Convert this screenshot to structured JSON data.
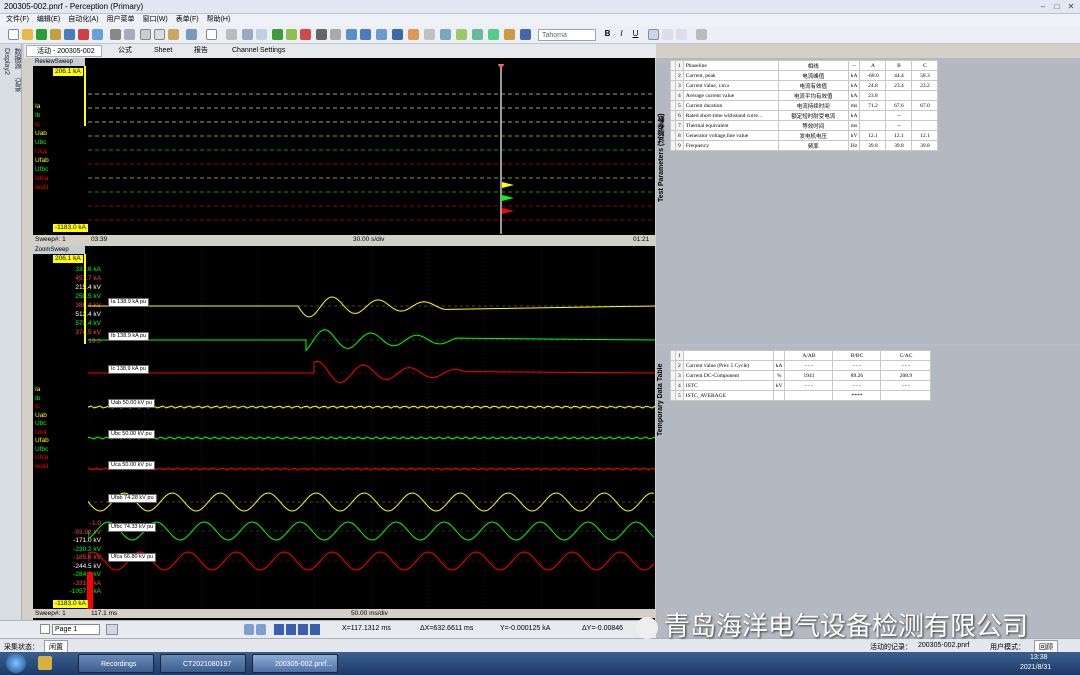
{
  "window": {
    "title": "200305-002.pnrf - Perception (Primary)"
  },
  "menu": [
    "文件(F)",
    "编辑(E)",
    "自动化(A)",
    "用户菜单",
    "窗口(W)",
    "表单(F)",
    "帮助(H)"
  ],
  "toolbar": {
    "font": "Tahoma",
    "bold": "B",
    "italic": "I",
    "underline": "U"
  },
  "tabs": [
    {
      "label": "活动 - 200305-002"
    },
    {
      "label": "公式"
    },
    {
      "label": "Sheet"
    },
    {
      "label": "报告"
    },
    {
      "label": "Channel Settings"
    }
  ],
  "left_strip": {
    "a": "Display2",
    "b": "数据源",
    "c": "记录"
  },
  "review": {
    "header": "ReviewSweep",
    "top_value": "206.1 kA",
    "bottom_value": "-1183.0 kA",
    "sweep": "Sweep#: 1",
    "time_start": "03:39",
    "time_div": "30.00 s/div",
    "time_end": "01:21",
    "channels": [
      {
        "name": "Ia",
        "color": "#ffff00"
      },
      {
        "name": "Ib",
        "color": "#00ff00"
      },
      {
        "name": "Ic",
        "color": "#ff0000"
      },
      {
        "name": "Uab",
        "color": "#ffff00"
      },
      {
        "name": "Ubc",
        "color": "#00ff00"
      },
      {
        "name": "Uca",
        "color": "#ff0000"
      },
      {
        "name": "Ufab",
        "color": "#ffff00"
      },
      {
        "name": "Ufbc",
        "color": "#00ff00"
      },
      {
        "name": "Ufca",
        "color": "#ff0000"
      },
      {
        "name": "Ieid1",
        "color": "#ff0000"
      }
    ]
  },
  "zoom": {
    "header": "ZoomSweep",
    "top_value": "206.1 kA",
    "scale_top": [
      "331.6 kA",
      "457.7 kA",
      "215.4 kV",
      "250.5 kV",
      "386.4 kV",
      "512.4 kV",
      "572.4 kV",
      "374.5 kV",
      "19.0"
    ],
    "scale_top_colors": [
      "#00ff00",
      "#ff4040",
      "#ffffff",
      "#00ff00",
      "#ff4040",
      "#ffffff",
      "#00ff00",
      "#ff4040",
      "#ff4040"
    ],
    "channels": [
      {
        "name": "Ia",
        "color": "#ffff00"
      },
      {
        "name": "Ib",
        "color": "#00ff00"
      },
      {
        "name": "Ic",
        "color": "#ff0000"
      },
      {
        "name": "Uab",
        "color": "#ffff00"
      },
      {
        "name": "Ubc",
        "color": "#00ff00"
      },
      {
        "name": "Uca",
        "color": "#ff0000"
      },
      {
        "name": "Ufab",
        "color": "#ffff00"
      },
      {
        "name": "Ufbc",
        "color": "#00ff00"
      },
      {
        "name": "Ufca",
        "color": "#ff0000"
      },
      {
        "name": "Ieid1",
        "color": "#ff0000"
      }
    ],
    "scale_bottom": [
      "-1.0",
      "-93.92 kV",
      "-171.0 kV",
      "-230.2 kV",
      "-185.6 kV",
      "-244.5 kV",
      "-284.6 kV",
      "-331.2 kA",
      "-1057.0 kA"
    ],
    "scale_bottom_colors": [
      "#ff4040",
      "#ff4040",
      "#ffffff",
      "#00ff00",
      "#ff4040",
      "#ffffff",
      "#00ff00",
      "#ff4040",
      "#00ff00"
    ],
    "bottom_value": "-1183.0 kA",
    "sweep": "Sweep#: 1",
    "time_start": "117.1 ms",
    "time_div": "50.00 ms/div",
    "signals": [
      {
        "label": "Ia 138.9 kA pu",
        "color": "#ffff00"
      },
      {
        "label": "Ib 138.9 kA pu",
        "color": "#00ff00"
      },
      {
        "label": "Ic 138.9 kA pu",
        "color": "#ff0000"
      },
      {
        "label": "Uab 50.00 kV pu",
        "color": "#ffff00"
      },
      {
        "label": "Ubc 50.00 kV pu",
        "color": "#00ff00"
      },
      {
        "label": "Uca 50.00 kV pu",
        "color": "#ff0000"
      },
      {
        "label": "Ufab 74.28 kV pu",
        "color": "#ffff00"
      },
      {
        "label": "Ufbc 74.33 kV pu",
        "color": "#00ff00"
      },
      {
        "label": "Ufca 66.80 kV pu",
        "color": "#ff0000"
      }
    ]
  },
  "status": {
    "page": "Page 1",
    "x": "X=117.1312 ms",
    "dx": "ΔX=632.6611 ms",
    "y": "Y=-0.000125 kA",
    "dy": "ΔY=-0.00846"
  },
  "test_params": {
    "title": "Test Parameters (试验参数)",
    "header": [
      "",
      "1",
      "Phaseline",
      "相线",
      "--",
      "A",
      "B",
      "C"
    ],
    "rows": [
      [
        "2",
        "Current, peak",
        "电流峰值",
        "kA",
        "-68.0",
        "44.4",
        "58.3"
      ],
      [
        "3",
        "Current value, r.m.s",
        "电流有效值",
        "kA",
        "24.8",
        "23.4",
        "23.2"
      ],
      [
        "4",
        "Average current value",
        "电流平均有效值",
        "kA",
        "23.8",
        "",
        ""
      ],
      [
        "5",
        "Current duration",
        "电流持续时间",
        "ms",
        "71.2",
        "67.6",
        "67.0"
      ],
      [
        "6",
        "Rated short-time withstand curre...",
        "额定短时耐受电流",
        "kA",
        "",
        "--",
        ""
      ],
      [
        "7",
        "Thermal equivalent",
        "等效时间",
        "ms",
        "",
        "--",
        ""
      ],
      [
        "8",
        "Generator voltage,line value",
        "发电机电压",
        "kV",
        "12.1",
        "12.1",
        "12.1"
      ],
      [
        "9",
        "Frequency",
        "频率",
        "Hz",
        "39.8",
        "39.8",
        "39.8"
      ]
    ]
  },
  "temp_table": {
    "title": "Temporary Data Table",
    "header": [
      "",
      "1",
      "",
      "",
      "A/AB",
      "B/BC",
      "C/AC"
    ],
    "rows": [
      [
        "2",
        "Current value (Prev 5 Cycle)",
        "kA",
        "- - -",
        "- - -",
        "- - -"
      ],
      [
        "3",
        "Current DC-Component",
        "%",
        "1941",
        "89.26",
        "208.9"
      ],
      [
        "4",
        "ISTC",
        "kV",
        "- - -",
        "- - -",
        "- - -"
      ],
      [
        "5",
        "ISTC_AVERAGE",
        "",
        "",
        "****",
        ""
      ]
    ]
  },
  "status_bottom": {
    "left": "采集状态：",
    "idle": "闲置",
    "activity": "活动的记录：",
    "file": "200305-002.pnrf",
    "usermode": "用户模式：",
    "mode": "回顾"
  },
  "taskbar": {
    "items": [
      "Recordings",
      "CT2021080197",
      "200305-002.pnrf..."
    ],
    "time": "13:38",
    "date": "2021/8/31"
  },
  "watermark": "青岛海洋电气设备检测有限公司"
}
